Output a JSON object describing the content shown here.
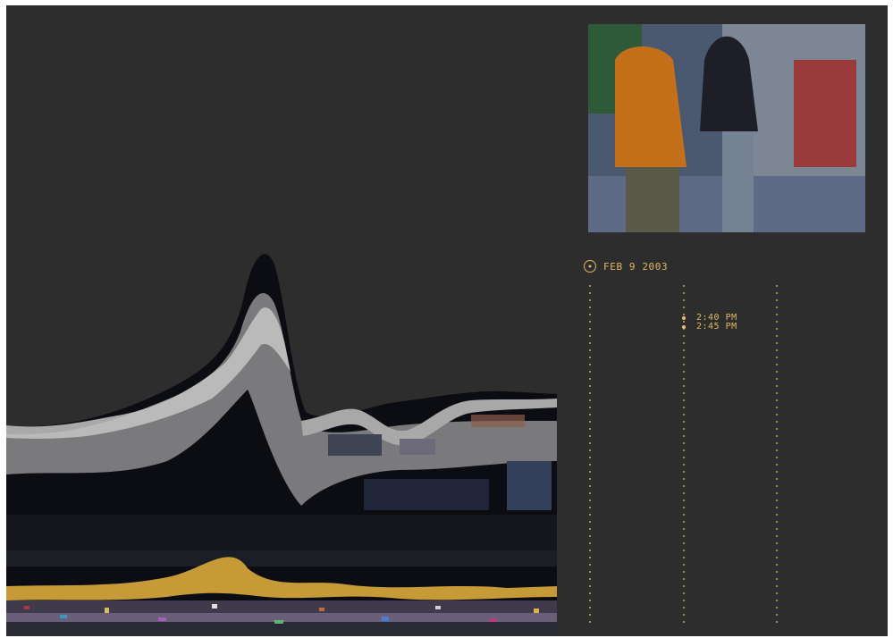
{
  "timeline": {
    "date_label": "FEB 9 2003",
    "entries": [
      {
        "time": "2:40 PM"
      },
      {
        "time": "2:45 PM"
      }
    ]
  },
  "icons": {
    "date_marker": "clock-icon",
    "entry_marker": "dot-icon"
  },
  "colors": {
    "background": "#2d2d2d",
    "accent": "#e2b85e"
  }
}
